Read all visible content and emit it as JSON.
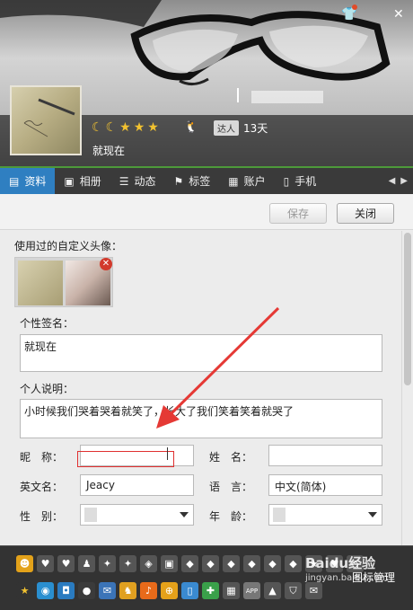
{
  "header": {
    "signature": "就现在",
    "rank_icons": [
      "moon-icon",
      "moon-icon",
      "star-icon",
      "star-icon",
      "star-icon"
    ],
    "daren_badge": "达人",
    "daren_days": "13天"
  },
  "tabs": [
    {
      "label": "资料",
      "icon": "id-card-icon",
      "active": true
    },
    {
      "label": "相册",
      "icon": "photo-icon",
      "active": false
    },
    {
      "label": "动态",
      "icon": "feed-icon",
      "active": false
    },
    {
      "label": "标签",
      "icon": "tag-icon",
      "active": false
    },
    {
      "label": "账户",
      "icon": "wallet-icon",
      "active": false
    },
    {
      "label": "手机",
      "icon": "phone-icon",
      "active": false
    }
  ],
  "actions": {
    "save": "保存",
    "close": "关闭"
  },
  "profile": {
    "avatars_label": "使用过的自定义头像：",
    "signature_label": "个性签名：",
    "signature_value": "就现在",
    "description_label": "个人说明：",
    "description_value": "小时候我们哭着哭着就笑了，长大了我们笑着笑着就哭了",
    "nickname_label": "昵　称：",
    "nickname_value": "",
    "name_label": "姓　名：",
    "name_value": "",
    "english_name_label": "英文名：",
    "english_name_value": "Jeacy",
    "language_label": "语　言：",
    "language_value": "中文(简体)",
    "gender_label": "性　别：",
    "gender_value": "",
    "age_label": "年　龄：",
    "age_value": ""
  },
  "iconbar": {
    "manage_label": "图标管理"
  },
  "watermark": {
    "brand": "Baidu经验",
    "url": "jingyan.baidu.com"
  },
  "colors": {
    "accent_tab": "#2f7fc1",
    "annotation_red": "#e03030",
    "tabbar_bg": "#3a3a3a"
  }
}
